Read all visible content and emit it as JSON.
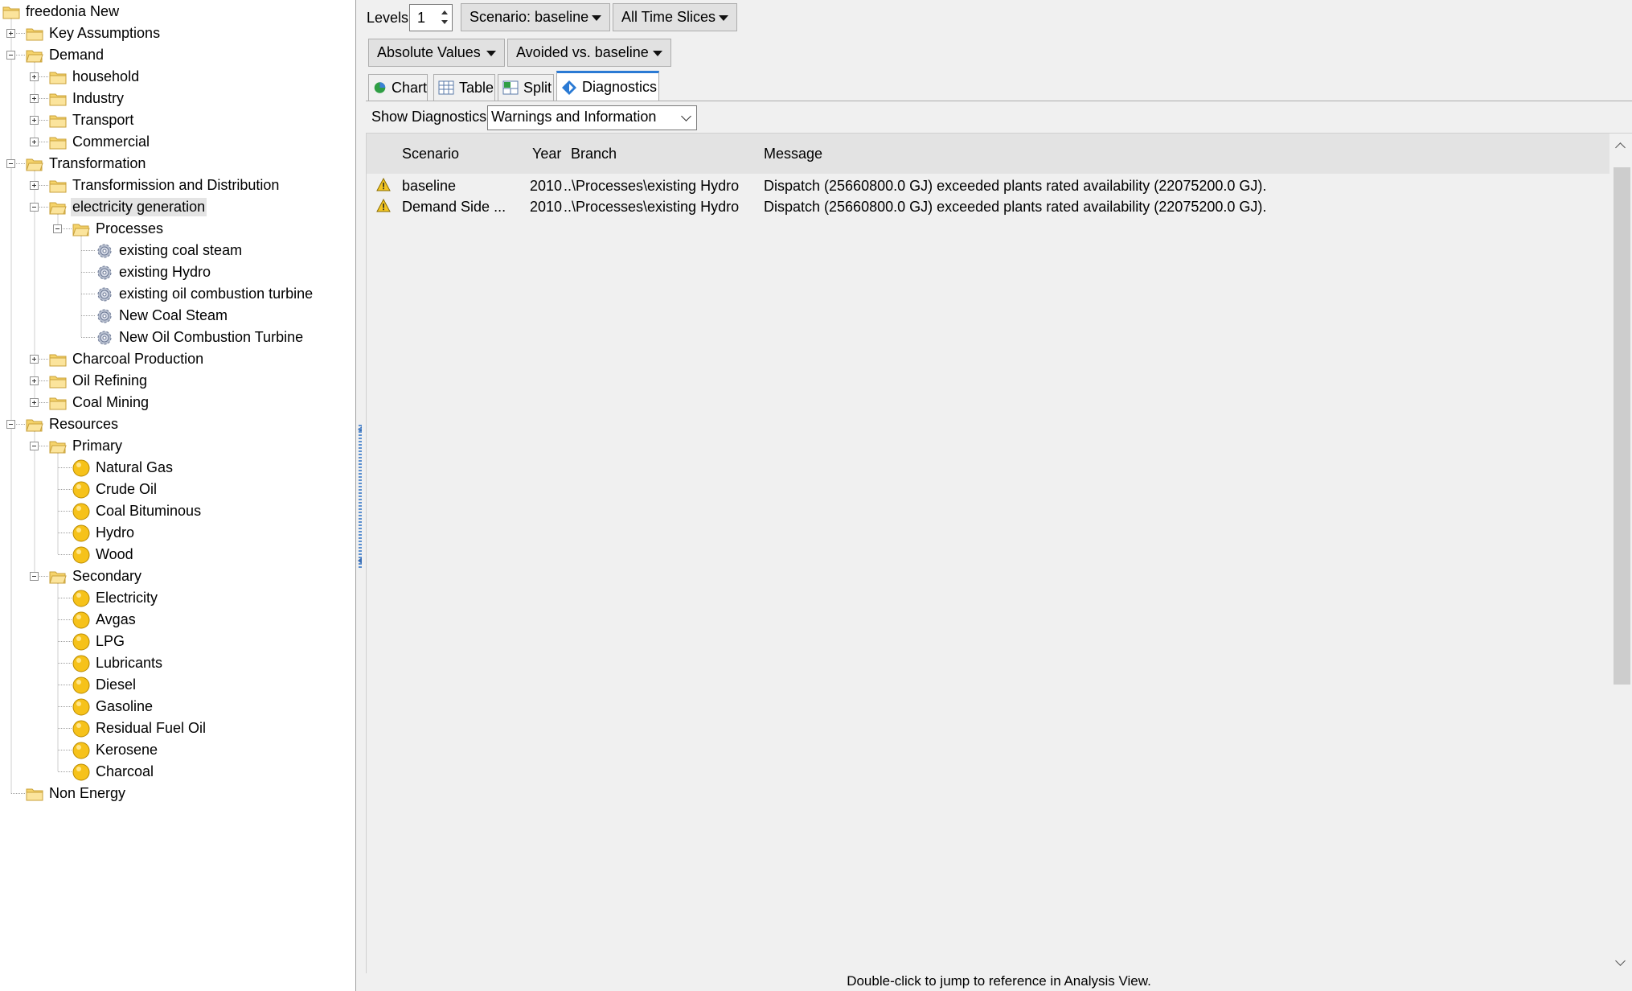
{
  "tree": {
    "items": [
      {
        "label": "freedonia New",
        "level": 0,
        "icon": "folder-icon",
        "expander": "none"
      },
      {
        "label": "Key Assumptions",
        "level": 1,
        "icon": "folder-icon",
        "expander": "plus"
      },
      {
        "label": "Demand",
        "level": 1,
        "icon": "folder-open-icon",
        "expander": "minus"
      },
      {
        "label": "household",
        "level": 2,
        "icon": "folder-icon",
        "expander": "plus"
      },
      {
        "label": "Industry",
        "level": 2,
        "icon": "folder-icon",
        "expander": "plus"
      },
      {
        "label": "Transport",
        "level": 2,
        "icon": "folder-icon",
        "expander": "plus"
      },
      {
        "label": "Commercial",
        "level": 2,
        "icon": "folder-icon",
        "expander": "plus"
      },
      {
        "label": "Transformation",
        "level": 1,
        "icon": "folder-open-icon",
        "expander": "minus"
      },
      {
        "label": "Transformission and Distribution",
        "level": 2,
        "icon": "folder-icon",
        "expander": "plus"
      },
      {
        "label": "electricity generation",
        "level": 2,
        "icon": "folder-open-icon",
        "expander": "minus",
        "selected": true
      },
      {
        "label": "Processes",
        "level": 3,
        "icon": "folder-open-icon",
        "expander": "minus"
      },
      {
        "label": "existing coal steam",
        "level": 4,
        "icon": "gear-icon",
        "expander": "none"
      },
      {
        "label": "existing Hydro",
        "level": 4,
        "icon": "gear-icon",
        "expander": "none"
      },
      {
        "label": "existing oil combustion turbine",
        "level": 4,
        "icon": "gear-icon",
        "expander": "none"
      },
      {
        "label": "New Coal Steam",
        "level": 4,
        "icon": "gear-icon",
        "expander": "none"
      },
      {
        "label": "New Oil Combustion Turbine",
        "level": 4,
        "icon": "gear-icon",
        "expander": "none"
      },
      {
        "label": "Charcoal Production",
        "level": 2,
        "icon": "folder-icon",
        "expander": "plus"
      },
      {
        "label": "Oil Refining",
        "level": 2,
        "icon": "folder-icon",
        "expander": "plus"
      },
      {
        "label": "Coal Mining",
        "level": 2,
        "icon": "folder-icon",
        "expander": "plus"
      },
      {
        "label": "Resources",
        "level": 1,
        "icon": "folder-open-icon",
        "expander": "minus"
      },
      {
        "label": "Primary",
        "level": 2,
        "icon": "folder-open-icon",
        "expander": "minus"
      },
      {
        "label": "Natural Gas",
        "level": 3,
        "icon": "fuel-ball-icon",
        "expander": "none"
      },
      {
        "label": "Crude Oil",
        "level": 3,
        "icon": "fuel-ball-icon",
        "expander": "none"
      },
      {
        "label": "Coal Bituminous",
        "level": 3,
        "icon": "fuel-ball-icon",
        "expander": "none"
      },
      {
        "label": "Hydro",
        "level": 3,
        "icon": "fuel-ball-icon",
        "expander": "none"
      },
      {
        "label": "Wood",
        "level": 3,
        "icon": "fuel-ball-icon",
        "expander": "none"
      },
      {
        "label": "Secondary",
        "level": 2,
        "icon": "folder-open-icon",
        "expander": "minus"
      },
      {
        "label": "Electricity",
        "level": 3,
        "icon": "fuel-ball-icon",
        "expander": "none"
      },
      {
        "label": "Avgas",
        "level": 3,
        "icon": "fuel-ball-icon",
        "expander": "none"
      },
      {
        "label": "LPG",
        "level": 3,
        "icon": "fuel-ball-icon",
        "expander": "none"
      },
      {
        "label": "Lubricants",
        "level": 3,
        "icon": "fuel-ball-icon",
        "expander": "none"
      },
      {
        "label": "Diesel",
        "level": 3,
        "icon": "fuel-ball-icon",
        "expander": "none"
      },
      {
        "label": "Gasoline",
        "level": 3,
        "icon": "fuel-ball-icon",
        "expander": "none"
      },
      {
        "label": "Residual Fuel Oil",
        "level": 3,
        "icon": "fuel-ball-icon",
        "expander": "none"
      },
      {
        "label": "Kerosene",
        "level": 3,
        "icon": "fuel-ball-icon",
        "expander": "none"
      },
      {
        "label": "Charcoal",
        "level": 3,
        "icon": "fuel-ball-icon",
        "expander": "none"
      },
      {
        "label": "Non Energy",
        "level": 1,
        "icon": "folder-icon",
        "expander": "none"
      }
    ]
  },
  "toolbar": {
    "levels_label": "Levels:",
    "levels_value": "1",
    "scenario_label": "Scenario: baseline",
    "time_slices_label": "All Time Slices",
    "absolute_values_label": "Absolute Values",
    "avoided_label": "Avoided vs. baseline"
  },
  "tabs": [
    {
      "label": "Chart",
      "icon": "chart-icon",
      "active": false
    },
    {
      "label": "Table",
      "icon": "table-icon",
      "active": false
    },
    {
      "label": "Split",
      "icon": "split-icon",
      "active": false
    },
    {
      "label": "Diagnostics",
      "icon": "diagnostics-icon",
      "active": true
    }
  ],
  "diagnostics": {
    "show_label": "Show Diagnostics:",
    "filter_value": "Warnings and Information",
    "columns": [
      "Scenario",
      "Year",
      "Branch",
      "Message"
    ],
    "rows": [
      {
        "icon": "warning-icon",
        "scenario": "baseline",
        "year": "2010",
        "branch": "..\\Processes\\existing Hydro",
        "message": "Dispatch (25660800.0 GJ) exceeded plants rated availability (22075200.0 GJ)."
      },
      {
        "icon": "warning-icon",
        "scenario": "Demand Side ...",
        "year": "2010",
        "branch": "..\\Processes\\existing Hydro",
        "message": "Dispatch (25660800.0 GJ) exceeded plants rated availability (22075200.0 GJ)."
      }
    ],
    "status_text": "Double-click to jump to reference in Analysis View."
  },
  "colors": {
    "folder": "#f5d36b",
    "folder_edge": "#c9a13a",
    "fuel_ball": "#f6c21a",
    "tab_accent": "#2a7ad4",
    "warning": "#f3c623"
  }
}
